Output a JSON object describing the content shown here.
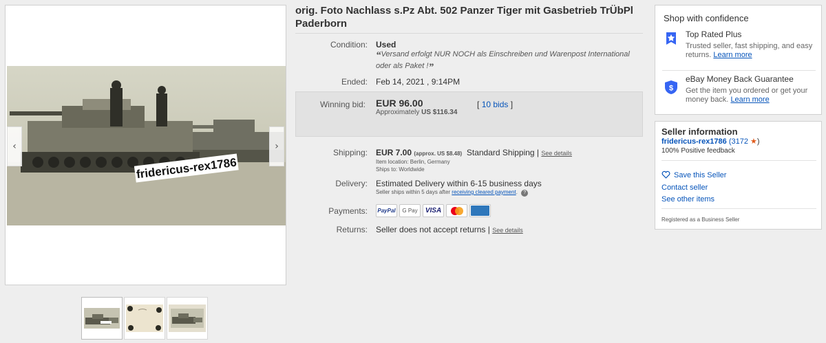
{
  "listing": {
    "title": "orig. Foto Nachlass s.Pz Abt. 502 Panzer Tiger mit Gasbetrieb TrÜbPl Paderborn",
    "watermark": "fridericus-rex1786"
  },
  "details": {
    "condition_label": "Condition:",
    "condition_value": "Used",
    "seller_notes": "Versand erfolgt NUR NOCH als Einschreiben und Warenpost International oder als Paket !",
    "ended_label": "Ended:",
    "ended_value": "Feb 14, 2021 , 9:14PM",
    "winning_bid_label": "Winning bid:",
    "winning_bid_value": "EUR 96.00",
    "approx_label": "Approximately",
    "approx_value": "US $116.34",
    "bids_open": "[",
    "bids_link": "10 bids",
    "bids_close": "]",
    "shipping_label": "Shipping:",
    "shipping_cost": "EUR 7.00",
    "shipping_approx": "(approx. US $8.48)",
    "shipping_service": "Standard Shipping |",
    "shipping_details": "See details",
    "item_location": "Item location:  Berlin, Germany",
    "ships_to": "Ships to:  Worldwide",
    "delivery_label": "Delivery:",
    "delivery_value": "Estimated Delivery within 6-15 business days",
    "delivery_note_prefix": "Seller ships within 5 days after",
    "delivery_note_link": "receiving cleared payment",
    "delivery_note_suffix": ".",
    "payments_label": "Payments:",
    "payment_methods": [
      "PayPal",
      "G Pay",
      "VISA",
      "MC",
      "AMEX"
    ],
    "returns_label": "Returns:",
    "returns_value": "Seller does not accept returns |",
    "returns_details": "See details"
  },
  "confidence": {
    "heading": "Shop with confidence",
    "top_rated_title": "Top Rated Plus",
    "top_rated_desc": "Trusted seller, fast shipping, and easy returns.",
    "top_rated_link": "Learn more",
    "guarantee_title": "eBay Money Back Guarantee",
    "guarantee_desc": "Get the item you ordered or get your money back.",
    "guarantee_link": "Learn more"
  },
  "seller": {
    "heading": "Seller information",
    "name": "fridericus-rex1786",
    "feedback_count": "(3172",
    "feedback_close": ")",
    "positive": "100% Positive feedback",
    "save": "Save this Seller",
    "contact": "Contact seller",
    "other_items": "See other items",
    "registered": "Registered as a Business Seller"
  },
  "colors": {
    "link": "#0654ba",
    "star": "#e05a1a",
    "shield": "#3665f3"
  }
}
